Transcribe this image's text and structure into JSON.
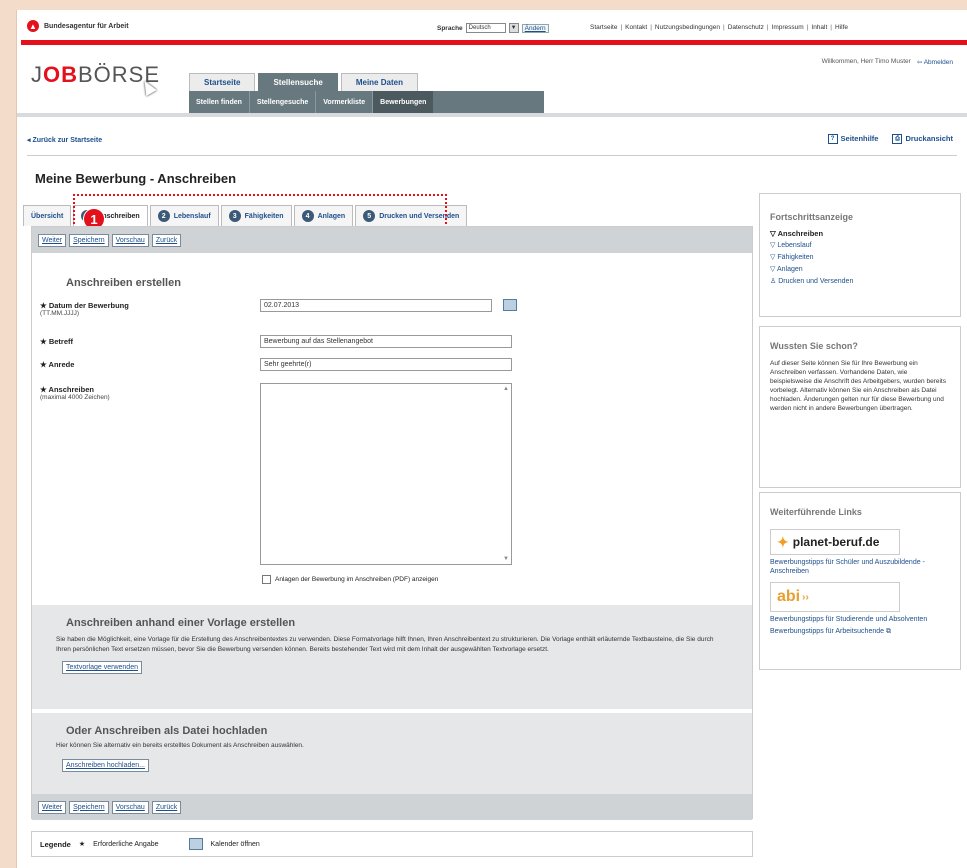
{
  "header": {
    "org_name": "Bundesagentur für Arbeit",
    "lang_label": "Sprache",
    "lang_value": "Deutsch",
    "change_btn": "Ändern",
    "links": [
      "Startseite",
      "Kontakt",
      "Nutzungsbedingungen",
      "Datenschutz",
      "Impressum",
      "Inhalt",
      "Hilfe"
    ],
    "welcome": "Willkommen, Herr Timo Muster",
    "logout": "Abmelden"
  },
  "brand": {
    "prefix": "J",
    "accent": "OB",
    "suffix": "BÖRSE"
  },
  "main_tabs": [
    "Startseite",
    "Stellensuche",
    "Meine Daten"
  ],
  "sub_nav": [
    "Stellen finden",
    "Stellengesuche",
    "Vormerkliste",
    "Bewerbungen"
  ],
  "back_link": "Zurück zur Startseite",
  "help": {
    "page_help": "Seitenhilfe",
    "print_view": "Druckansicht"
  },
  "page_title": "Meine Bewerbung - Anschreiben",
  "step_tabs": {
    "overview": "Übersicht",
    "steps": [
      {
        "num": "1",
        "label": "Anschreiben"
      },
      {
        "num": "2",
        "label": "Lebenslauf"
      },
      {
        "num": "3",
        "label": "Fähigkeiten"
      },
      {
        "num": "4",
        "label": "Anlagen"
      },
      {
        "num": "5",
        "label": "Drucken und Versenden"
      }
    ]
  },
  "badge": "1",
  "buttons": {
    "next": "Weiter",
    "save": "Speichern",
    "preview": "Vorschau",
    "back": "Zurück"
  },
  "form": {
    "section_title": "Anschreiben erstellen",
    "date_label": "Datum der Bewerbung",
    "date_hint": "(TT.MM.JJJJ)",
    "date_value": "02.07.2013",
    "subject_label": "Betreff",
    "subject_value": "Bewerbung auf das Stellenangebot",
    "salutation_label": "Anrede",
    "salutation_value": "Sehr geehrte(r)",
    "letter_label": "Anschreiben",
    "letter_hint": "(maximal 4000 Zeichen)",
    "attach_checkbox": "Anlagen der Bewerbung im Anschreiben (PDF) anzeigen"
  },
  "template_section": {
    "title": "Anschreiben anhand einer Vorlage erstellen",
    "text": "Sie haben die Möglichkeit, eine Vorlage für die Erstellung des Anschreibentextes zu verwenden. Diese Formatvorlage hilft Ihnen, Ihren Anschreibentext zu strukturieren. Die Vorlage enthält erläuternde Textbausteine, die Sie durch Ihren persönlichen Text ersetzen müssen, bevor Sie die Bewerbung versenden können. Bereits bestehender Text wird mit dem Inhalt der ausgewählten Textvorlage ersetzt.",
    "button": "Textvorlage verwenden"
  },
  "upload_section": {
    "title": "Oder Anschreiben als Datei hochladen",
    "text": "Hier können Sie alternativ ein bereits erstelltes Dokument als Anschreiben auswählen.",
    "button": "Anschreiben hochladen..."
  },
  "legend": {
    "label": "Legende",
    "required": "Erforderliche Angabe",
    "calendar": "Kalender öffnen"
  },
  "progress": {
    "title": "Fortschrittsanzeige",
    "items": [
      "Anschreiben",
      "Lebenslauf",
      "Fähigkeiten",
      "Anlagen",
      "Drucken und Versenden"
    ]
  },
  "did_you_know": {
    "title": "Wussten Sie schon?",
    "text": "Auf dieser Seite können Sie für Ihre Bewerbung ein Anschreiben verfassen. Vorhandene Daten, wie beispielsweise die Anschrift des Arbeitgebers, wurden bereits vorbelegt. Alternativ können Sie ein Anschreiben als Datei hochladen. Änderungen gelten nur für diese Bewerbung und werden nicht in andere Bewerbungen übertragen."
  },
  "links_box": {
    "title": "Weiterführende Links",
    "planet_logo": "planet-beruf.de",
    "planet_link": "Bewerbungstipps für Schüler und Auszubildende - Anschreiben",
    "abi_logo": "abi",
    "abi_link": "Bewerbungstipps für Studierende und Absolventen",
    "job_link": "Bewerbungstipps für Arbeitsuchende"
  },
  "colors": {
    "accent_red": "#e4111d",
    "nav_gray": "#68787f",
    "link_blue": "#1d4f8c"
  }
}
